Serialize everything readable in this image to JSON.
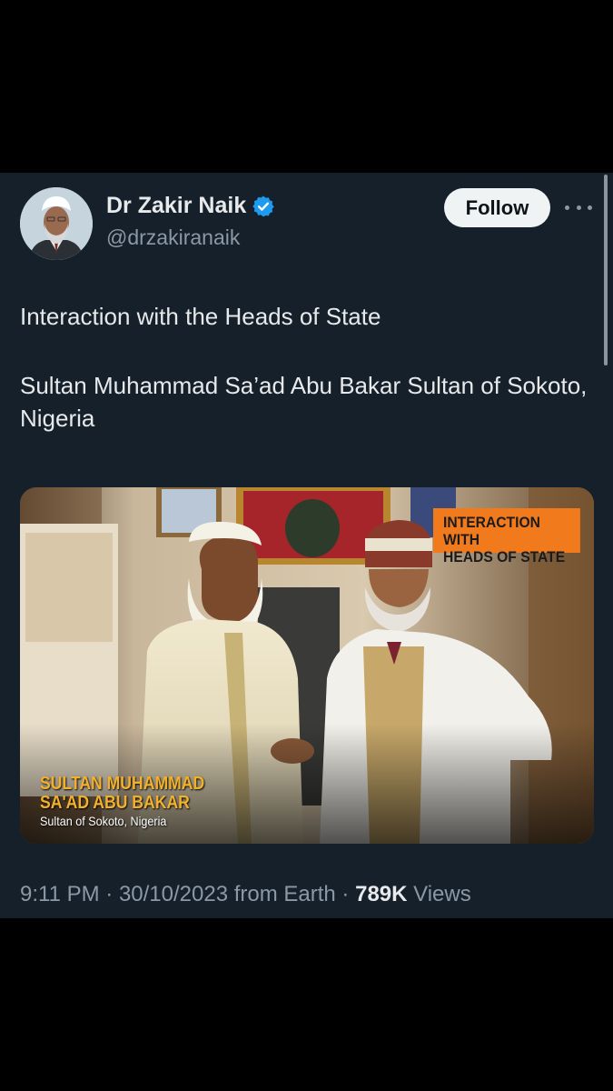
{
  "tweet": {
    "author": {
      "name": "Dr Zakir Naik",
      "handle": "@drzakiranaik",
      "verified": true,
      "verified_color": "#1d9bf0"
    },
    "follow_label": "Follow",
    "more_icon": "more-horizontal-icon",
    "text": {
      "line1": "Interaction with the Heads of State",
      "line2": "Sultan Muhammad Sa’ad Abu Bakar Sultan of Sokoto, Nigeria"
    },
    "media": {
      "badge": "INTERACTION WITH\nHEADS OF STATE",
      "badge_color": "#f07a1c",
      "caption_name": "SULTAN MUHAMMAD\nSA'AD ABU BAKAR",
      "caption_sub": "Sultan of Sokoto, Nigeria"
    },
    "meta": {
      "time": "9:11 PM",
      "separator": " · ",
      "date": "30/10/2023",
      "source": "from Earth",
      "views_count": "789K",
      "views_label": "Views"
    }
  }
}
